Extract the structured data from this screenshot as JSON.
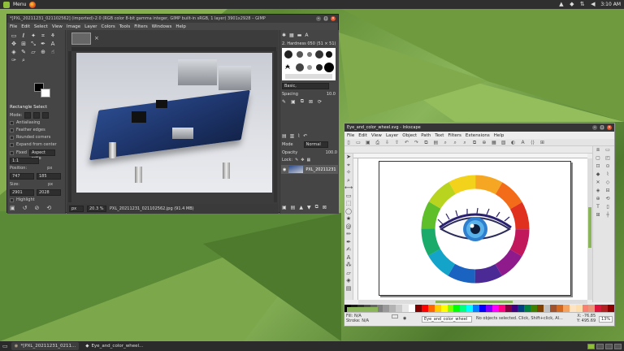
{
  "top_panel": {
    "menu_label": "Menu",
    "clock": "3:10 AM"
  },
  "gimp": {
    "title": "*[PXL_20211231_021102562] (imported)-2.0 (RGB color 8-bit gamma integer, GIMP built-in sRGB, 1 layer) 3901x2928 – GIMP",
    "menu": [
      "File",
      "Edit",
      "Select",
      "View",
      "Image",
      "Layer",
      "Colors",
      "Tools",
      "Filters",
      "Windows",
      "Help"
    ],
    "tool_options": {
      "title": "Rectangle Select",
      "mode_label": "Mode:",
      "antialiasing": "Antialiasing",
      "feather_edges": "Feather edges",
      "rounded_corners": "Rounded corners",
      "expand_from_center": "Expand from center",
      "fixed_label": "Fixed",
      "fixed_value": "Aspect ratio",
      "ratio_value": "1:1",
      "position_label": "Position:",
      "position_unit": "px",
      "pos_x": "747",
      "pos_y": "185",
      "size_label": "Size:",
      "size_unit": "px",
      "size_w": "2901",
      "size_h": "2028",
      "highlight": "Highlight"
    },
    "status": {
      "unit": "px",
      "zoom": "20.3 %",
      "filename": "PXL_20211231_021102562.jpg (91.4 MB)"
    },
    "dock": {
      "brush_name": "2. Hardness 050 (51 × 51)",
      "preset": "Basic,",
      "spacing_label": "Spacing",
      "spacing_value": "10.0",
      "mode_label": "Mode",
      "mode_value": "Normal",
      "opacity_label": "Opacity",
      "opacity_value": "100.0",
      "lock_label": "Lock:",
      "layer_name": "PXL_20211231"
    }
  },
  "inkscape": {
    "title": "Eye_and_color_wheel.svg - Inkscape",
    "menu": [
      "File",
      "Edit",
      "View",
      "Layer",
      "Object",
      "Path",
      "Text",
      "Filters",
      "Extensions",
      "Help"
    ],
    "status": {
      "fill_label": "Fill:",
      "fill_value": "N/A",
      "stroke_label": "Stroke:",
      "stroke_value": "N/A",
      "layer": "Eye_and_color_wheel",
      "message": "No objects selected. Click, Shift+click, Al...",
      "x_label": "X:",
      "x_value": "-76.85",
      "y_label": "Y:",
      "y_value": "495.69",
      "zoom": "13%"
    },
    "palette": [
      "#000000",
      "#1a1a1a",
      "#333333",
      "#4d4d4d",
      "#666666",
      "#808080",
      "#999999",
      "#b3b3b3",
      "#cccccc",
      "#e6e6e6",
      "#ffffff",
      "#800000",
      "#ff0000",
      "#ff6600",
      "#ffcc00",
      "#ffff00",
      "#80ff00",
      "#00ff00",
      "#00ff80",
      "#00ffff",
      "#0080ff",
      "#0000ff",
      "#8000ff",
      "#ff00ff",
      "#ff0080",
      "#800040",
      "#400080",
      "#004080",
      "#008040",
      "#408000",
      "#804000",
      "#c0c0c0",
      "#a0522d",
      "#d2691e",
      "#f4a460",
      "#ffe4c4",
      "#ffdead",
      "#fa8072",
      "#e9967a",
      "#dc143c",
      "#b22222",
      "#8b0000"
    ]
  },
  "taskbar": {
    "gimp_task": "*[PXL_20211231_0211...",
    "ink_task": "Eye_and_color_wheel..."
  }
}
